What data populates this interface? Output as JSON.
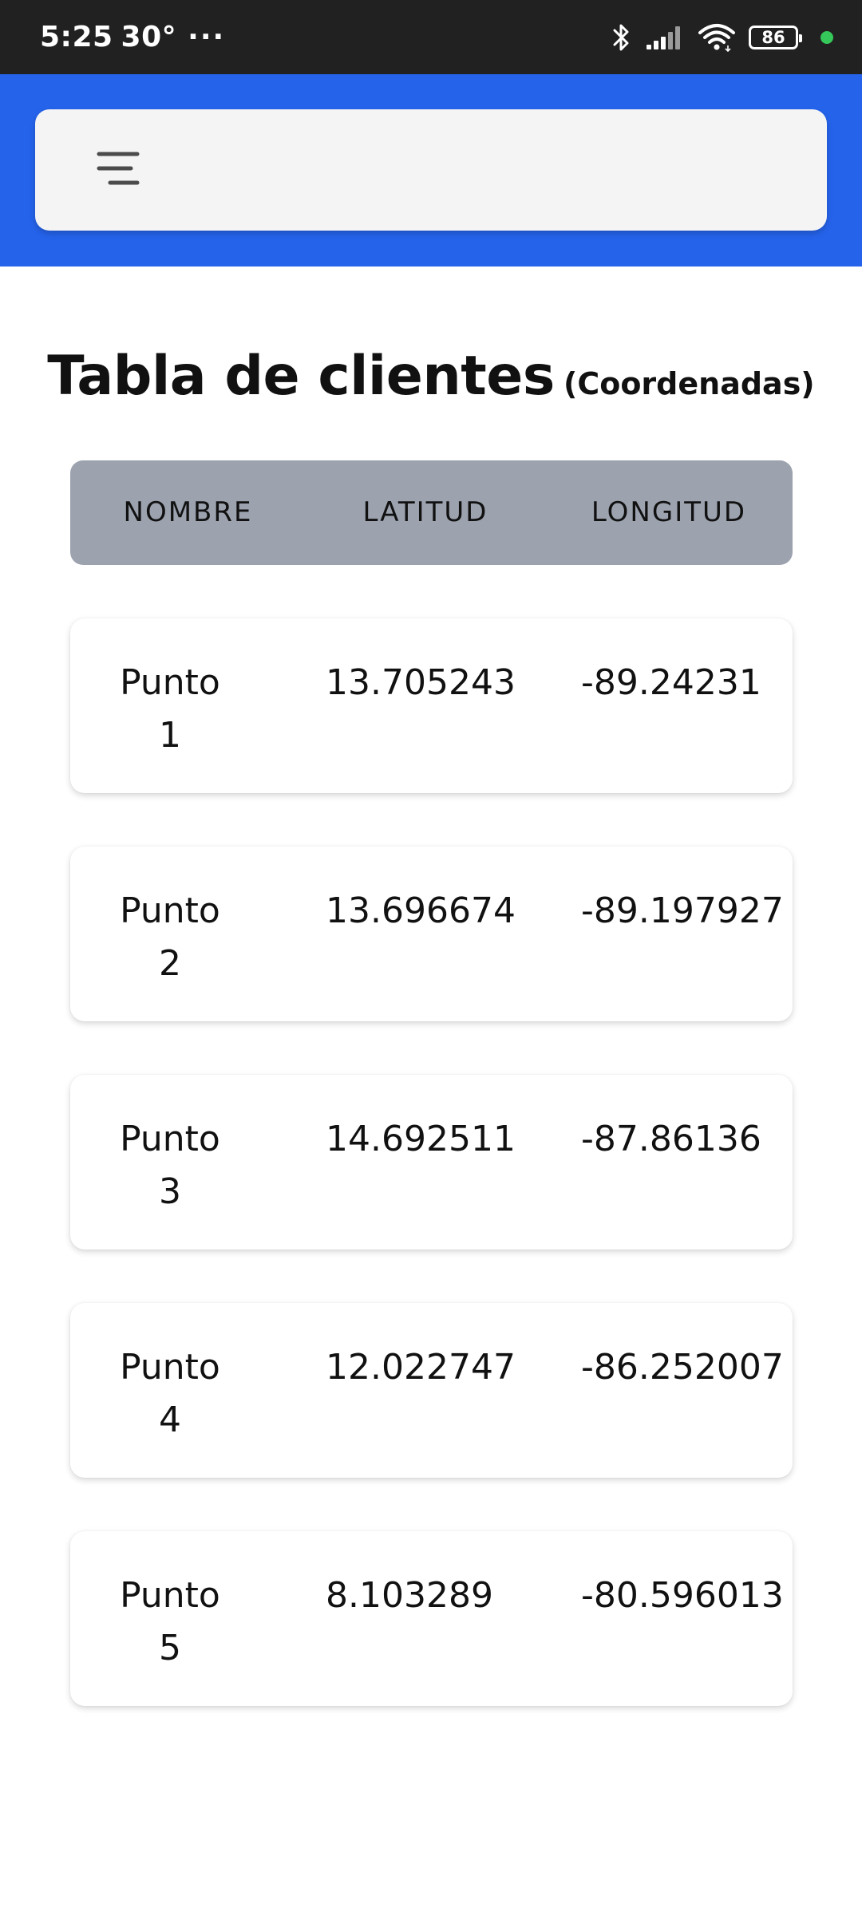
{
  "status_bar": {
    "time": "5:25",
    "temperature": "30°",
    "more": "···",
    "battery": "86",
    "icons": [
      "bluetooth-icon",
      "signal-icon",
      "wifi-icon",
      "battery-icon",
      "privacy-dot-icon"
    ]
  },
  "header": {
    "menu_icon": "menu-icon",
    "background_color": "#2563eb"
  },
  "page": {
    "title": "Tabla de clientes",
    "subtitle": "(Coordenadas)"
  },
  "table": {
    "columns": [
      "NOMBRE",
      "LATITUD",
      "LONGITUD"
    ],
    "rows": [
      {
        "name_line1": "Punto",
        "name_line2": "1",
        "lat": "13.705243",
        "lng": "-89.24231"
      },
      {
        "name_line1": "Punto",
        "name_line2": "2",
        "lat": "13.696674",
        "lng": "-89.197927"
      },
      {
        "name_line1": "Punto",
        "name_line2": "3",
        "lat": "14.692511",
        "lng": "-87.86136"
      },
      {
        "name_line1": "Punto",
        "name_line2": "4",
        "lat": "12.022747",
        "lng": "-86.252007"
      },
      {
        "name_line1": "Punto",
        "name_line2": "5",
        "lat": "8.103289",
        "lng": "-80.596013"
      }
    ]
  },
  "colors": {
    "status_bar": "#212121",
    "header": "#2563eb",
    "table_header": "#9ca3af",
    "privacy_dot": "#35c759"
  }
}
